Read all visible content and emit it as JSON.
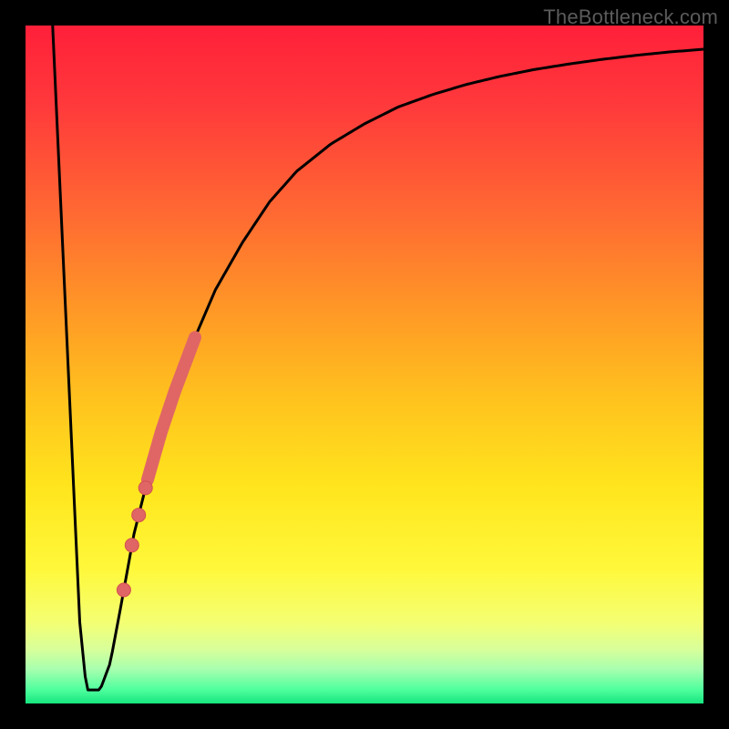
{
  "watermark": "TheBottleneck.com",
  "colors": {
    "line": "#000000",
    "dot": "#e06666",
    "dot_stroke": "#d24f4f"
  },
  "chart_data": {
    "type": "line",
    "title": "",
    "xlabel": "",
    "ylabel": "",
    "xlim": [
      0,
      100
    ],
    "ylim": [
      0,
      100
    ],
    "series": [
      {
        "name": "bottleneck-curve",
        "comment": "Approximate percentage trace read off gradient bands; y=0 is bottom (green), y=100 is top (red).",
        "x": [
          4.0,
          8.0,
          9.0,
          10.0,
          11.0,
          12.5,
          14.0,
          16.0,
          18.0,
          20.0,
          22.0,
          25.0,
          28.0,
          32.0,
          36.0,
          40.0,
          45.0,
          50.0,
          55.0,
          60.0,
          65.0,
          70.0,
          75.0,
          80.0,
          85.0,
          90.0,
          95.0,
          100.0
        ],
        "y": [
          100.0,
          12.0,
          2.0,
          2.0,
          2.0,
          6.0,
          14.0,
          25.0,
          33.0,
          40.0,
          46.0,
          54.0,
          61.0,
          68.0,
          74.0,
          78.5,
          82.5,
          85.5,
          88.0,
          89.8,
          91.3,
          92.5,
          93.5,
          94.3,
          95.0,
          95.6,
          96.1,
          96.5
        ]
      }
    ],
    "annotations": {
      "highlight_segment": {
        "comment": "Thick pink band roughly between these x positions along the curve",
        "x_start": 18.0,
        "x_end": 25.0
      },
      "dots_x": [
        14.5,
        15.7,
        16.7,
        17.7
      ]
    }
  }
}
